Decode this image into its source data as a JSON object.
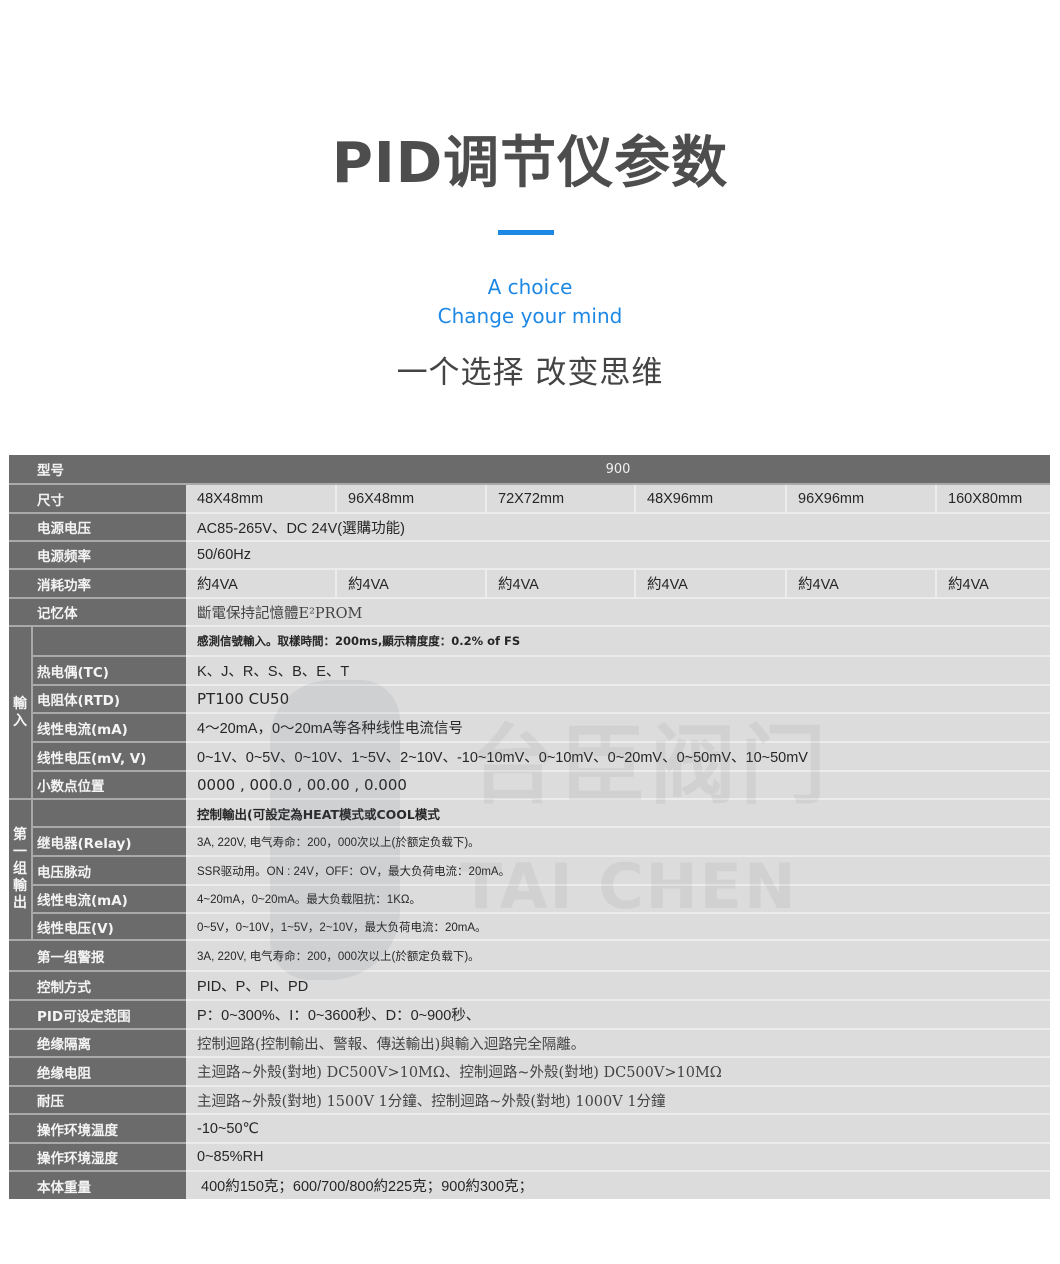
{
  "header": {
    "title": "PID调节仪参数",
    "subtitle_en_1": "A choice",
    "subtitle_en_2": "Change your mind",
    "subtitle_cn": "一个选择  改变思维",
    "accent_color": "#1e88e5"
  },
  "table": {
    "model_label": "型号",
    "model_value": "900",
    "size_label": "尺寸",
    "sizes": [
      "48X48mm",
      "96X48mm",
      "72X72mm",
      "48X96mm",
      "96X96mm",
      "160X80mm"
    ],
    "power_voltage_label": "电源电压",
    "power_voltage": "AC85-265V、DC 24V(選購功能)",
    "power_freq_label": "电源频率",
    "power_freq": "50/60Hz",
    "power_consumption_label": "消耗功率",
    "power_consumption": [
      "約4VA",
      "約4VA",
      "約4VA",
      "約4VA",
      "約4VA",
      "約4VA"
    ],
    "memory_label": "记忆体",
    "memory": "斷電保持記憶體E²PROM",
    "input_group": {
      "label": "輸入",
      "intro": "感測信號輸入。取樣時間：200ms,顯示精度度：0.2% of FS",
      "rows": [
        {
          "label": "热电偶(TC)",
          "value": "K、J、R、S、B、E、T"
        },
        {
          "label": "电阻体(RTD)",
          "value": "PT100  CU50"
        },
        {
          "label": "线性电流(mA)",
          "value": "4～20mA，0～20mA等各种线性电流信号"
        },
        {
          "label": "线性电压(mV, V)",
          "value": "0~1V、0~5V、0~10V、1~5V、2~10V、-10~10mV、0~10mV、0~20mV、0~50mV、10~50mV"
        },
        {
          "label": "小数点位置",
          "value": "0000 , 000.0 , 00.00 , 0.000"
        }
      ]
    },
    "output_group": {
      "label": "第一组輸出",
      "intro": "控制輸出(可設定為HEAT模式或COOL模式",
      "rows": [
        {
          "label": "继电器(Relay)",
          "value": "3A, 220V, 电气寿命：200，000次以上(於额定负载下)。"
        },
        {
          "label": "电压脉动",
          "value": "SSR驱动用。ON : 24V，OFF：OV，最大负荷电流：20mA。"
        },
        {
          "label": "线性电流(mA)",
          "value": "4~20mA，0~20mA。最大负载阻抗：1KΩ。"
        },
        {
          "label": "线性电压(V)",
          "value": "0~5V，0~10V，1~5V，2~10V，最大负荷电流：20mA。"
        }
      ]
    },
    "rows_bottom": [
      {
        "label": "第一组警报",
        "value": "3A, 220V, 电气寿命：200，000次以上(於额定负载下)。"
      },
      {
        "label": "控制方式",
        "value": "PID、P、PI、PD"
      },
      {
        "label": "PID可设定范围",
        "value": "P：0~300%、I：0~3600秒、D：0~900秒、"
      },
      {
        "label": "绝缘隔离",
        "value": "控制迴路(控制輸出、警報、傳送輸出)與輸入迴路完全隔離。"
      },
      {
        "label": "绝缘电阻",
        "value": "主迴路~外殼(對地)  DC500V>10MΩ、控制迴路~外殼(對地)  DC500V>10MΩ"
      },
      {
        "label": "耐压",
        "value": "主迴路~外殼(對地)  1500V 1分鐘、控制迴路~外殼(對地) 1000V 1分鐘"
      },
      {
        "label": "操作环境温度",
        "value": "-10~50℃"
      },
      {
        "label": "操作环境湿度",
        "value": "0~85%RH"
      },
      {
        "label": "本体重量",
        "value": "400約150克；600/700/800約225克；900約300克；"
      }
    ]
  },
  "watermark": {
    "brand_cn": "台臣阀门",
    "brand_en": "TAI CHEN"
  }
}
